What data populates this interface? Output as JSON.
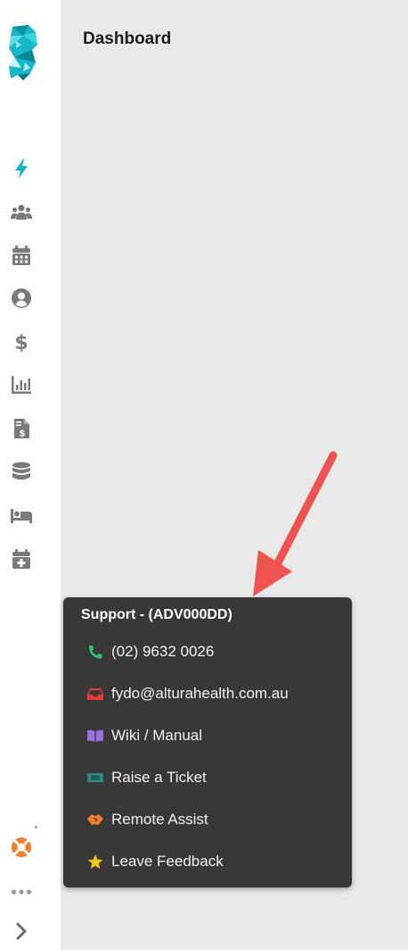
{
  "header": {
    "title": "Dashboard"
  },
  "sidebar": {
    "nav_icons": [
      "lightning-icon",
      "users-icon",
      "calendar-icon",
      "user-circle-icon",
      "dollar-icon",
      "bar-chart-icon",
      "invoice-icon",
      "database-icon",
      "bed-icon",
      "calendar-plus-icon"
    ],
    "bottom_icons": [
      "lifebuoy-icon",
      "more-dots-icon",
      "chevron-right-icon"
    ]
  },
  "support_popup": {
    "title": "Support - (ADV000DD)",
    "items": [
      {
        "label": "(02) 9632 0026",
        "icon": "phone-icon"
      },
      {
        "label": "fydo@alturahealth.com.au",
        "icon": "inbox-icon"
      },
      {
        "label": "Wiki / Manual",
        "icon": "book-icon"
      },
      {
        "label": "Raise a Ticket",
        "icon": "ticket-icon"
      },
      {
        "label": "Remote Assist",
        "icon": "handshake-icon"
      },
      {
        "label": "Leave Feedback",
        "icon": "star-icon"
      }
    ]
  },
  "colors": {
    "accent": "#13b5c8",
    "icon_gray": "#7a7a7a",
    "popup_bg": "#383838",
    "arrow": "#ef5350",
    "lifebuoy": "#f47c2a"
  }
}
